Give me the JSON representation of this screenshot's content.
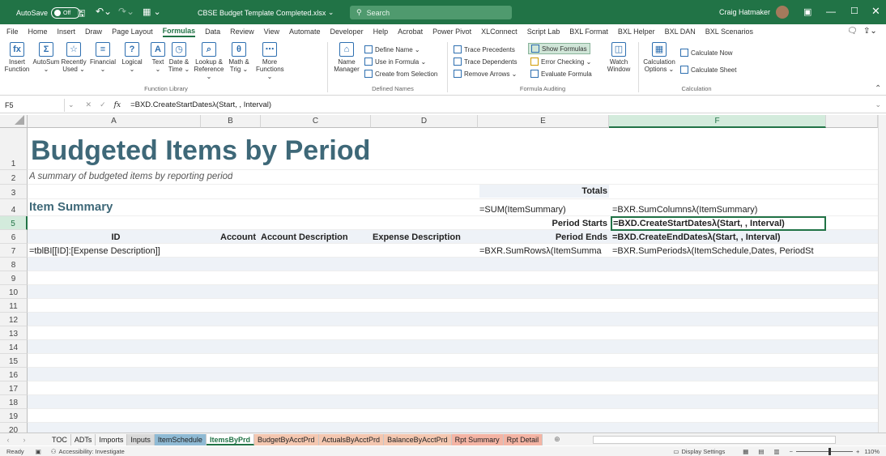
{
  "titlebar": {
    "autosave_label": "AutoSave",
    "autosave_state": "Off",
    "file_name": "CBSE Budget Template Completed.xlsx",
    "search_placeholder": "Search",
    "user_name": "Craig Hatmaker"
  },
  "ribbon_tabs": [
    "File",
    "Home",
    "Insert",
    "Draw",
    "Page Layout",
    "Formulas",
    "Data",
    "Review",
    "View",
    "Automate",
    "Developer",
    "Help",
    "Acrobat",
    "Power Pivot",
    "XLConnect",
    "Script Lab",
    "BXL Format",
    "BXL Helper",
    "BXL DAN",
    "BXL Scenarios"
  ],
  "active_tab": "Formulas",
  "ribbon": {
    "function_library": {
      "buttons": [
        {
          "label1": "Insert",
          "label2": "Function",
          "icon": "fx-icon"
        },
        {
          "label1": "AutoSum",
          "label2": "⌄",
          "icon": "sigma-icon"
        },
        {
          "label1": "Recently",
          "label2": "Used ⌄",
          "icon": "star-icon"
        },
        {
          "label1": "Financial",
          "label2": "⌄",
          "icon": "database-icon"
        },
        {
          "label1": "Logical",
          "label2": "⌄",
          "icon": "question-icon"
        },
        {
          "label1": "Text",
          "label2": "⌄",
          "icon": "text-icon"
        },
        {
          "label1": "Date &",
          "label2": "Time ⌄",
          "icon": "clock-icon"
        },
        {
          "label1": "Lookup &",
          "label2": "Reference ⌄",
          "icon": "lookup-icon"
        },
        {
          "label1": "Math &",
          "label2": "Trig ⌄",
          "icon": "theta-icon"
        },
        {
          "label1": "More",
          "label2": "Functions ⌄",
          "icon": "more-icon"
        }
      ],
      "group_label": "Function Library"
    },
    "defined_names": {
      "name_manager1": "Name",
      "name_manager2": "Manager",
      "define_name": "Define Name ⌄",
      "use_in_formula": "Use in Formula ⌄",
      "create_from_selection": "Create from Selection",
      "group_label": "Defined Names"
    },
    "formula_auditing": {
      "trace_precedents": "Trace Precedents",
      "trace_dependents": "Trace Dependents",
      "remove_arrows": "Remove Arrows ⌄",
      "show_formulas": "Show Formulas",
      "error_checking": "Error Checking ⌄",
      "evaluate_formula": "Evaluate Formula",
      "watch1": "Watch",
      "watch2": "Window",
      "group_label": "Formula Auditing"
    },
    "calculation": {
      "options1": "Calculation",
      "options2": "Options ⌄",
      "calc_now": "Calculate Now",
      "calc_sheet": "Calculate Sheet",
      "group_label": "Calculation"
    }
  },
  "formula_bar": {
    "name_box": "F5",
    "fx": "fx",
    "formula": "=BXD.CreateStartDatesλ(Start, , Interval)"
  },
  "columns": [
    "A",
    "B",
    "C",
    "D",
    "E",
    "F"
  ],
  "rows": [
    "1",
    "2",
    "3",
    "4",
    "5",
    "6",
    "7",
    "8",
    "9",
    "10",
    "11",
    "12",
    "13",
    "14",
    "15",
    "16",
    "17",
    "18",
    "19",
    "20"
  ],
  "cells": {
    "title": "Budgeted Items by Period",
    "subtitle": "A summary of budgeted items by reporting period",
    "totals": "Totals",
    "item_summary": "Item Summary",
    "e4": "=SUM(ItemSummary)",
    "f4": "=BXR.SumColumnsλ(ItemSummary)",
    "period_starts": "Period Starts",
    "f5": "=BXD.CreateStartDatesλ(Start, , Interval)",
    "id": "ID",
    "account": "Account",
    "account_desc": "Account Description",
    "expense_desc": "Expense Description",
    "period_ends": "Period Ends",
    "f6": "=BXD.CreateEndDatesλ(Start, , Interval)",
    "a7": "=tblBI[[ID]:[Expense Description]]",
    "e7": "=BXR.SumRowsλ(ItemSumma",
    "f7": "=BXR.SumPeriodsλ(ItemSchedule,Dates, PeriodSt"
  },
  "sheet_tabs": [
    {
      "label": "TOC",
      "color": "#f3f3f3"
    },
    {
      "label": "ADTs",
      "color": "#f3f3f3"
    },
    {
      "label": "Imports",
      "color": "#f3f3f3"
    },
    {
      "label": "Inputs",
      "color": "#d9d9d9"
    },
    {
      "label": "ItemSchedule",
      "color": "#8fbad4"
    },
    {
      "label": "ItemsByPrd",
      "color": "#ffffff",
      "active": true
    },
    {
      "label": "BudgetByAcctPrd",
      "color": "#f4c7b0"
    },
    {
      "label": "ActualsByAcctPrd",
      "color": "#f4c7b0"
    },
    {
      "label": "BalanceByAcctPrd",
      "color": "#f4c7b0"
    },
    {
      "label": "Rpt Summary",
      "color": "#f4b4a4"
    },
    {
      "label": "Rpt Detail",
      "color": "#f4b4a4"
    }
  ],
  "status": {
    "ready": "Ready",
    "accessibility": "Accessibility: Investigate",
    "display_settings": "Display Settings",
    "zoom": "110%"
  },
  "colors": {
    "brand": "#217346",
    "heading": "#3e6878",
    "band": "#eef2f7"
  }
}
